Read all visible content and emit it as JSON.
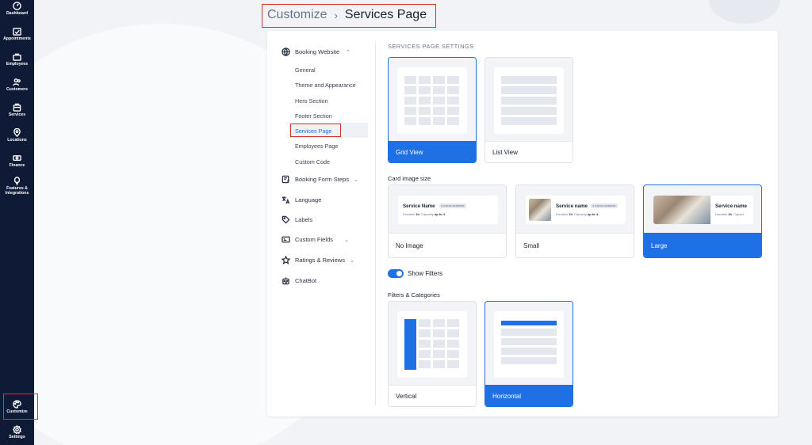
{
  "nav": {
    "items": [
      {
        "label": "Dashboard",
        "icon": "dashboard-icon"
      },
      {
        "label": "Appointments",
        "icon": "calendar-check-icon"
      },
      {
        "label": "Employees",
        "icon": "employees-icon"
      },
      {
        "label": "Customers",
        "icon": "customers-icon"
      },
      {
        "label": "Services",
        "icon": "services-icon"
      },
      {
        "label": "Locations",
        "icon": "location-pin-icon"
      },
      {
        "label": "Finance",
        "icon": "finance-icon"
      },
      {
        "label": "Features &",
        "label2": "Integrations",
        "icon": "lightbulb-icon"
      },
      {
        "label": "Customize",
        "icon": "palette-icon"
      },
      {
        "label": "Settings",
        "icon": "gear-icon"
      }
    ],
    "active": "Customize"
  },
  "breadcrumb": {
    "parent": "Customize",
    "separator": "›",
    "current": "Services Page"
  },
  "settings_menu": {
    "booking_website": "Booking Website",
    "sub_items": [
      "General",
      "Theme and Appearance",
      "Hero Section",
      "Footer Section",
      "Services Page",
      "Employees Page",
      "Custom Code"
    ],
    "active_sub": "Services Page",
    "items": [
      {
        "label": "Booking Form Steps",
        "chevron": "⌄"
      },
      {
        "label": "Language"
      },
      {
        "label": "Labels"
      },
      {
        "label": "Custom Fields",
        "chevron": "⌄"
      },
      {
        "label": "Ratings & Reviews",
        "chevron": "⌄"
      },
      {
        "label": "ChatBot"
      }
    ],
    "expand_chevron": "⌃"
  },
  "content": {
    "heading": "SERVICES PAGE SETTINGS",
    "view_options": [
      {
        "label": "Grid View",
        "selected": true
      },
      {
        "label": "List View",
        "selected": false
      }
    ],
    "card_image_size_label": "Card image size",
    "image_size_options": [
      {
        "label": "No Image",
        "selected": false,
        "service_name": "Service Name",
        "badge": "4 extras available",
        "duration_label": "Duration",
        "duration": "1h",
        "capacity_label": "Capacity",
        "capacity": "up to 4"
      },
      {
        "label": "Small",
        "selected": false,
        "service_name": "Service name",
        "badge": "4 extras available",
        "duration_label": "Duration",
        "duration": "1h",
        "capacity_label": "Capacity",
        "capacity": "up to 4"
      },
      {
        "label": "Large",
        "selected": true,
        "service_name": "Service name",
        "duration_label": "Duration",
        "duration": "1h",
        "capacity_label": "Capaci"
      }
    ],
    "show_filters_label": "Show Filters",
    "show_filters_on": true,
    "filters_label": "Filters & Categories",
    "filter_options": [
      {
        "label": "Vertical",
        "selected": false
      },
      {
        "label": "Horizontal",
        "selected": true
      }
    ]
  },
  "colors": {
    "accent": "#1f6fe5",
    "nav_bg": "#0f1a36",
    "highlight_box": "#d9342b"
  }
}
